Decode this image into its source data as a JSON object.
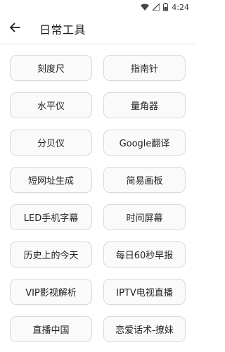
{
  "status_bar": {
    "time": "4:24",
    "icons": [
      "wifi-icon",
      "signal-icon",
      "battery-icon"
    ]
  },
  "header": {
    "back_icon": "arrow-left-icon",
    "title": "日常工具"
  },
  "tools": [
    {
      "label": "刻度尺"
    },
    {
      "label": "指南针"
    },
    {
      "label": "水平仪"
    },
    {
      "label": "量角器"
    },
    {
      "label": "分贝仪"
    },
    {
      "label": "Google翻译"
    },
    {
      "label": "短网址生成"
    },
    {
      "label": "简易画板"
    },
    {
      "label": "LED手机字幕"
    },
    {
      "label": "时间屏幕"
    },
    {
      "label": "历史上的今天"
    },
    {
      "label": "每日60秒早报"
    },
    {
      "label": "VIP影视解析"
    },
    {
      "label": "IPTV电视直播"
    },
    {
      "label": "直播中国"
    },
    {
      "label": "恋爱话术-撩妹"
    }
  ],
  "colors": {
    "background": "#ffffff",
    "button_border": "#d9d9d9",
    "button_fill": "#fafafa",
    "text": "#222222"
  }
}
